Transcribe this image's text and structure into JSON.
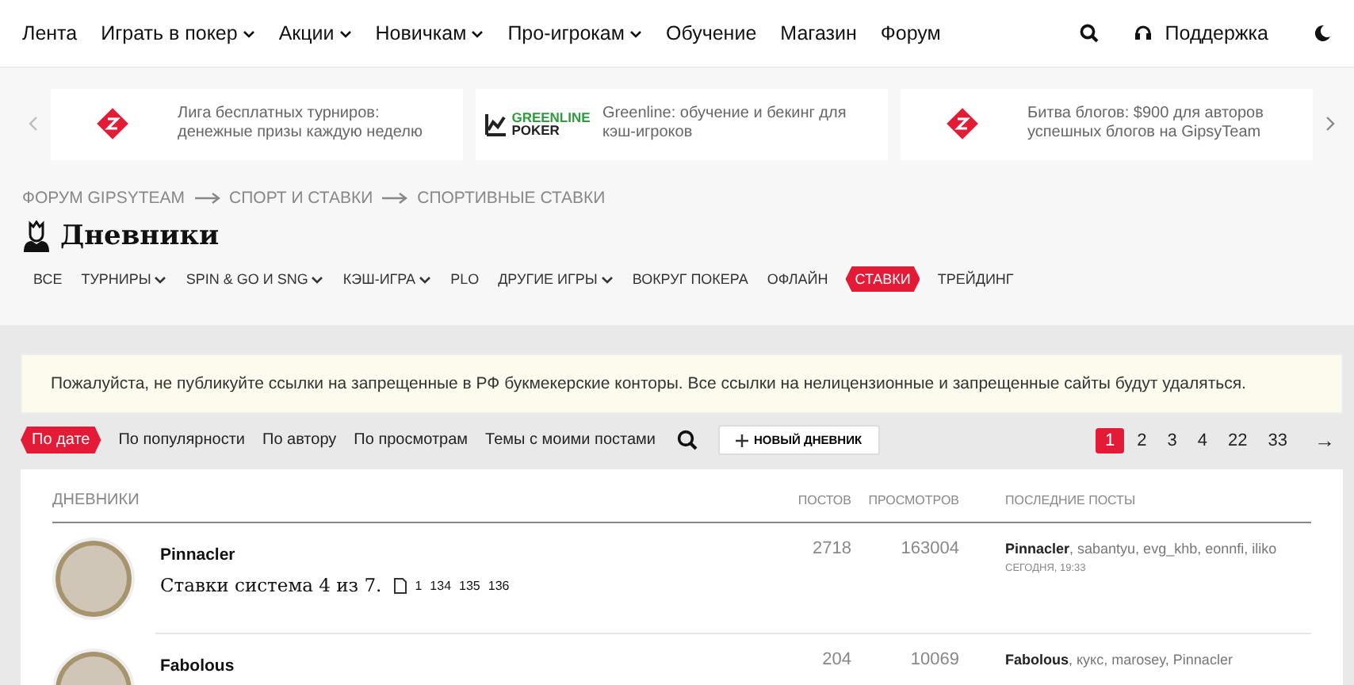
{
  "nav": {
    "items": [
      {
        "label": "Лента",
        "dropdown": false
      },
      {
        "label": "Играть в покер",
        "dropdown": true
      },
      {
        "label": "Акции",
        "dropdown": true
      },
      {
        "label": "Новичкам",
        "dropdown": true
      },
      {
        "label": "Про-игрокам",
        "dropdown": true
      },
      {
        "label": "Обучение",
        "dropdown": false
      },
      {
        "label": "Магазин",
        "dropdown": false
      },
      {
        "label": "Форум",
        "dropdown": false
      }
    ],
    "support": "Поддержка"
  },
  "banners": [
    {
      "kind": "gipsy",
      "text": "Лига бесплатных турниров: денежные призы каждую неделю"
    },
    {
      "kind": "greenline",
      "logo_top": "GREENLINE",
      "logo_bottom": "POKER",
      "text": "Greenline: обучение и бекинг для кэш-игроков"
    },
    {
      "kind": "gipsy",
      "text": "Битва блогов: $900 для авторов успешных блогов на GipsyTeam"
    }
  ],
  "breadcrumbs": [
    "ФОРУМ GIPSYTEAM",
    "СПОРТ И СТАВКИ",
    "СПОРТИВНЫЕ СТАВКИ"
  ],
  "title": "Дневники",
  "categories": [
    {
      "label": "ВСЕ",
      "dropdown": false,
      "selected": false
    },
    {
      "label": "ТУРНИРЫ",
      "dropdown": true,
      "selected": false
    },
    {
      "label": "SPIN & GO И SNG",
      "dropdown": true,
      "selected": false
    },
    {
      "label": "КЭШ-ИГРА",
      "dropdown": true,
      "selected": false
    },
    {
      "label": "PLO",
      "dropdown": false,
      "selected": false
    },
    {
      "label": "ДРУГИЕ ИГРЫ",
      "dropdown": true,
      "selected": false
    },
    {
      "label": "ВОКРУГ ПОКЕРА",
      "dropdown": false,
      "selected": false
    },
    {
      "label": "ОФЛАЙН",
      "dropdown": false,
      "selected": false
    },
    {
      "label": "СТАВКИ",
      "dropdown": false,
      "selected": true
    },
    {
      "label": "ТРЕЙДИНГ",
      "dropdown": false,
      "selected": false
    }
  ],
  "notice": "Пожалуйста, не публикуйте ссылки на запрещенные в РФ букмекерские конторы. Все ссылки на нелицензионные и запрещенные сайты будут удаляться.",
  "sort_tabs": [
    {
      "label": "По дате",
      "selected": true
    },
    {
      "label": "По популярности",
      "selected": false
    },
    {
      "label": "По автору",
      "selected": false
    },
    {
      "label": "По просмотрам",
      "selected": false
    },
    {
      "label": "Темы с моими постами",
      "selected": false
    }
  ],
  "new_button": "НОВЫЙ ДНЕВНИК",
  "pagination": {
    "pages": [
      {
        "label": "1",
        "selected": true
      },
      {
        "label": "2",
        "selected": false
      },
      {
        "label": "3",
        "selected": false
      },
      {
        "label": "4",
        "selected": false
      },
      {
        "label": "22",
        "selected": false
      },
      {
        "label": "33",
        "selected": false
      }
    ],
    "next": "→"
  },
  "table": {
    "columns": [
      "ДНЕВНИКИ",
      "ПОСТОВ",
      "ПРОСМОТРОВ",
      "ПОСЛЕДНИЕ ПОСТЫ"
    ],
    "rows": [
      {
        "author": "Pinnacler",
        "topic": "Ставки система 4 из 7.",
        "pages": [
          "1",
          "134",
          "135",
          "136"
        ],
        "posts": "2718",
        "views": "163004",
        "last_posters": "**Pinnacler**, sabantyu, evg_khb, eonnfi, iliko",
        "last_time": "СЕГОДНЯ, 19:33"
      },
      {
        "author": "Fabolous",
        "posts": "204",
        "views": "10069",
        "last_posters": "**Fabolous**, кукс, marosey, Pinnacler"
      }
    ]
  }
}
